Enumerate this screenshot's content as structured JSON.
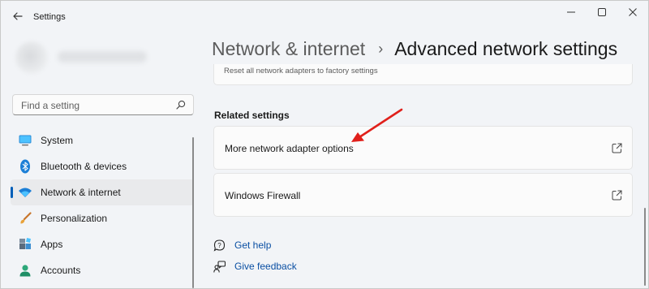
{
  "window": {
    "app_title": "Settings",
    "controls": [
      "minimize-icon",
      "maximize-icon",
      "close-icon"
    ]
  },
  "sidebar": {
    "search": {
      "placeholder": "Find a setting",
      "value": ""
    },
    "items": [
      {
        "label": "System",
        "icon": "system-icon",
        "active": false
      },
      {
        "label": "Bluetooth & devices",
        "icon": "bluetooth-icon",
        "active": false
      },
      {
        "label": "Network & internet",
        "icon": "wifi-icon",
        "active": true
      },
      {
        "label": "Personalization",
        "icon": "brush-icon",
        "active": false
      },
      {
        "label": "Apps",
        "icon": "apps-icon",
        "active": false
      },
      {
        "label": "Accounts",
        "icon": "person-icon",
        "active": false
      }
    ]
  },
  "header": {
    "parent": "Network & internet",
    "separator": "›",
    "current": "Advanced network settings"
  },
  "main": {
    "top_card_text": "Reset all network adapters to factory settings",
    "related_title": "Related settings",
    "related": [
      {
        "label": "More network adapter options",
        "icon": "open-external-icon"
      },
      {
        "label": "Windows Firewall",
        "icon": "open-external-icon"
      }
    ],
    "help": [
      {
        "label": "Get help",
        "icon": "help-icon"
      },
      {
        "label": "Give feedback",
        "icon": "feedback-icon"
      }
    ]
  },
  "colors": {
    "accent": "#005fb8",
    "link": "#0a4fa3",
    "annotation_arrow": "#e0201b"
  }
}
